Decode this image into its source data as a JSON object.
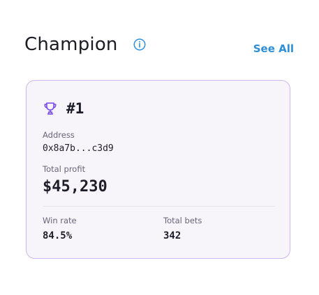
{
  "header": {
    "title": "Champion",
    "info_icon": "info-circle-icon",
    "see_all_label": "See All"
  },
  "colors": {
    "accent": "#2f8fd7",
    "card_border": "#cdb7ef",
    "trophy": "#7b4fe6",
    "card_background": "#f7f5f9"
  },
  "card": {
    "icon": "trophy-icon",
    "rank": "#1",
    "address": {
      "label": "Address",
      "value": "0x8a7b...c3d9"
    },
    "total_profit": {
      "label": "Total profit",
      "value": "$45,230"
    },
    "win_rate": {
      "label": "Win rate",
      "value": "84.5%"
    },
    "total_bets": {
      "label": "Total bets",
      "value": "342"
    }
  }
}
